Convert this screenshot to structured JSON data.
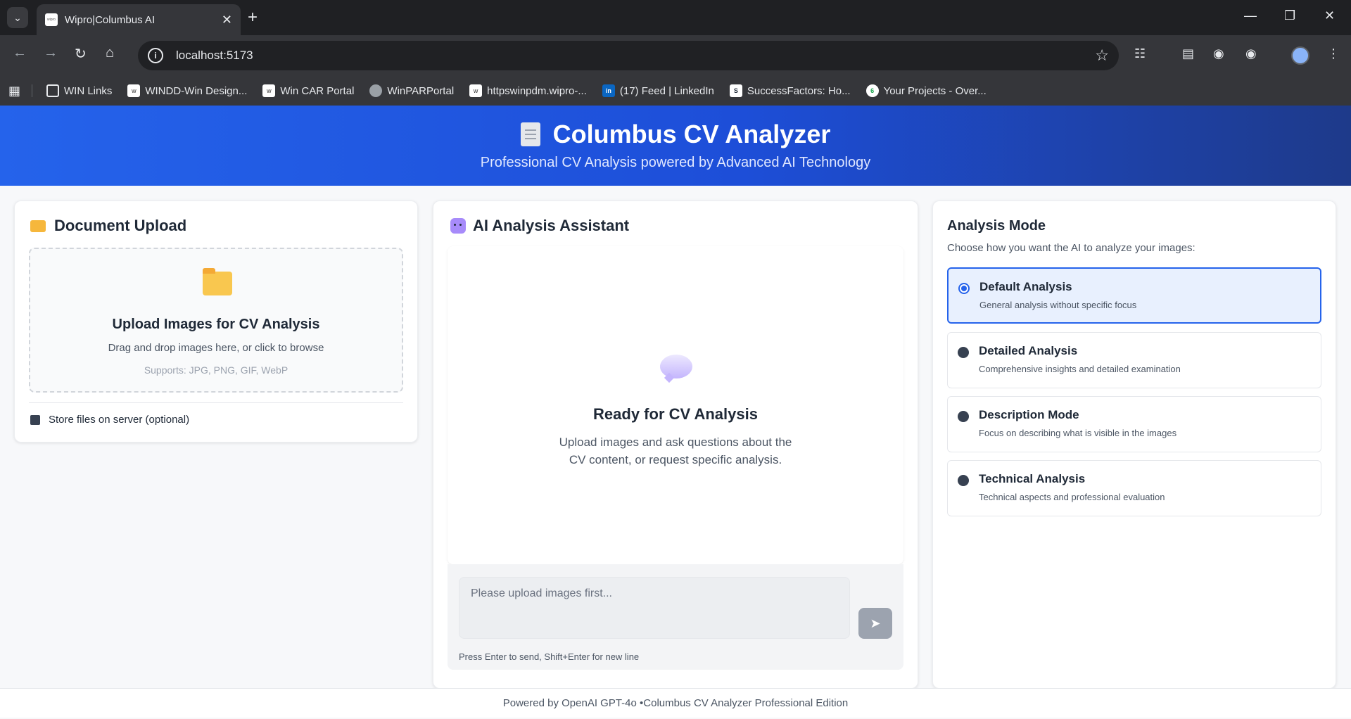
{
  "browser": {
    "tab_title": "Wipro|Columbus AI",
    "url": "localhost:5173",
    "bookmarks": [
      {
        "label": "WIN Links",
        "icon": "folder-icon"
      },
      {
        "label": "WINDD-Win Design...",
        "icon": "wipro-icon"
      },
      {
        "label": "Win CAR Portal",
        "icon": "portal-icon"
      },
      {
        "label": "WinPARPortal",
        "icon": "globe-icon"
      },
      {
        "label": "httpswinpdm.wipro-...",
        "icon": "wipro-icon"
      },
      {
        "label": "(17) Feed | LinkedIn",
        "icon": "linkedin-icon"
      },
      {
        "label": "SuccessFactors: Ho...",
        "icon": "successfactors-icon"
      },
      {
        "label": "Your Projects - Over...",
        "icon": "projects-icon"
      }
    ]
  },
  "header": {
    "title": "Columbus CV Analyzer",
    "subtitle": "Professional CV Analysis powered by Advanced AI Technology"
  },
  "upload": {
    "title": "Document Upload",
    "dropzone_title": "Upload Images for CV Analysis",
    "dropzone_sub": "Drag and drop images here, or click to browse",
    "dropzone_hint": "Supports: JPG, PNG, GIF, WebP",
    "store_label": "Store files on server (optional)"
  },
  "chat": {
    "title": "AI Analysis Assistant",
    "ready_title": "Ready for CV Analysis",
    "ready_line1": "Upload images and ask questions about the",
    "ready_line2": "CV content, or request specific analysis.",
    "input_placeholder": "Please upload images first...",
    "hint": "Press Enter to send, Shift+Enter for new line"
  },
  "mode": {
    "title": "Analysis Mode",
    "subtitle": "Choose how you want the AI to analyze your images:",
    "options": [
      {
        "name": "Default Analysis",
        "desc": "General analysis without specific focus",
        "selected": true
      },
      {
        "name": "Detailed Analysis",
        "desc": "Comprehensive insights and detailed examination",
        "selected": false
      },
      {
        "name": "Description Mode",
        "desc": "Focus on describing what is visible in the images",
        "selected": false
      },
      {
        "name": "Technical Analysis",
        "desc": "Technical aspects and professional evaluation",
        "selected": false
      }
    ]
  },
  "footer": {
    "text": "Powered by OpenAI GPT-4o •Columbus CV Analyzer Professional Edition"
  },
  "colors": {
    "header_start": "#2563eb",
    "header_end": "#1e3a8a",
    "accent": "#2563eb",
    "selected_bg": "#e8f0fe"
  }
}
